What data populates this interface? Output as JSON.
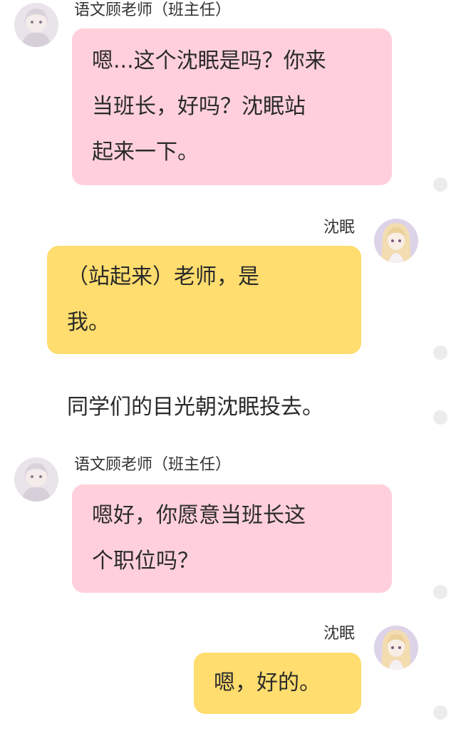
{
  "messages": [
    {
      "speaker": "语文顾老师（班主任）",
      "lines": [
        "嗯...这个沈眠是吗？你来",
        "当班长，好吗？沈眠站",
        "起来一下。"
      ]
    },
    {
      "speaker": "沈眠",
      "lines": [
        "（站起来）老师，是",
        "我。"
      ]
    },
    {
      "narration": "同学们的目光朝沈眠投去。"
    },
    {
      "speaker": "语文顾老师（班主任）",
      "lines": [
        "嗯好，你愿意当班长这",
        "个职位吗？"
      ]
    },
    {
      "speaker": "沈眠",
      "lines": [
        "嗯，好的。"
      ]
    }
  ],
  "avatars": {
    "teacher": "teacher-avatar",
    "student": "shen-mian-avatar"
  },
  "colors": {
    "left_bubble": "#ffd0dc",
    "right_bubble": "#ffdd6e",
    "background": "#ffffff",
    "dot": "#ececec"
  }
}
